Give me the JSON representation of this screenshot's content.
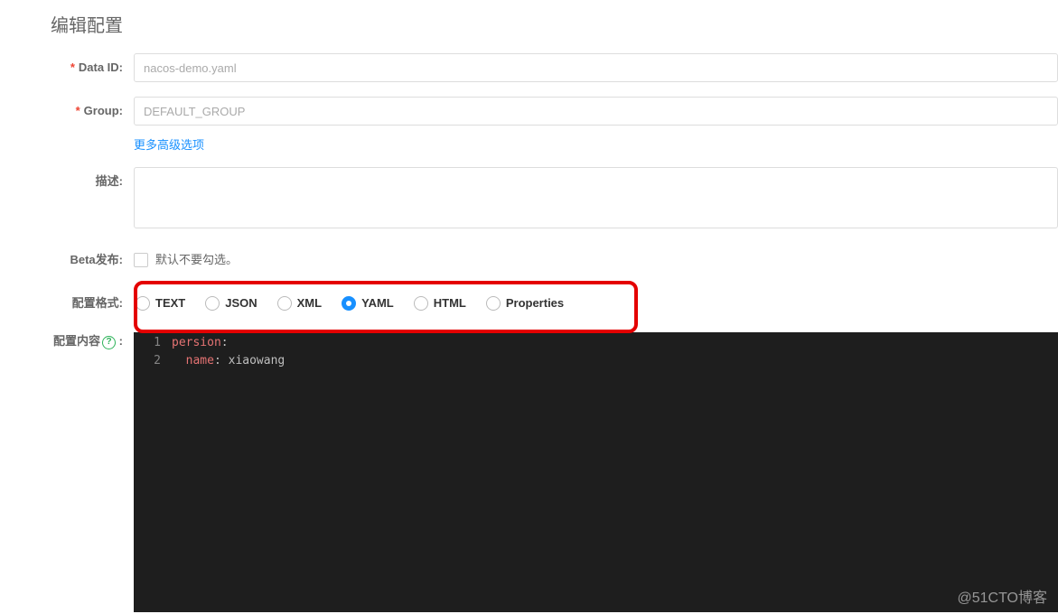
{
  "page_title": "编辑配置",
  "labels": {
    "data_id": "Data ID:",
    "group": "Group:",
    "desc": "描述:",
    "beta": "Beta发布:",
    "format": "配置格式:",
    "content": "配置内容"
  },
  "fields": {
    "data_id": "nacos-demo.yaml",
    "group": "DEFAULT_GROUP",
    "desc": ""
  },
  "more_link": "更多高级选项",
  "beta_checkbox": {
    "checked": false,
    "label": "默认不要勾选。"
  },
  "formats": [
    {
      "label": "TEXT",
      "selected": false
    },
    {
      "label": "JSON",
      "selected": false
    },
    {
      "label": "XML",
      "selected": false
    },
    {
      "label": "YAML",
      "selected": true
    },
    {
      "label": "HTML",
      "selected": false
    },
    {
      "label": "Properties",
      "selected": false
    }
  ],
  "editor": {
    "lines": [
      {
        "n": 1,
        "tokens": [
          {
            "t": "persion",
            "c": "hl-key"
          },
          {
            "t": ":",
            "c": "hl-val"
          }
        ]
      },
      {
        "n": 2,
        "tokens": [
          {
            "t": "  ",
            "c": ""
          },
          {
            "t": "name",
            "c": "hl-key"
          },
          {
            "t": ": xiaowang",
            "c": "hl-val"
          }
        ]
      }
    ]
  },
  "watermark": "@51CTO博客"
}
